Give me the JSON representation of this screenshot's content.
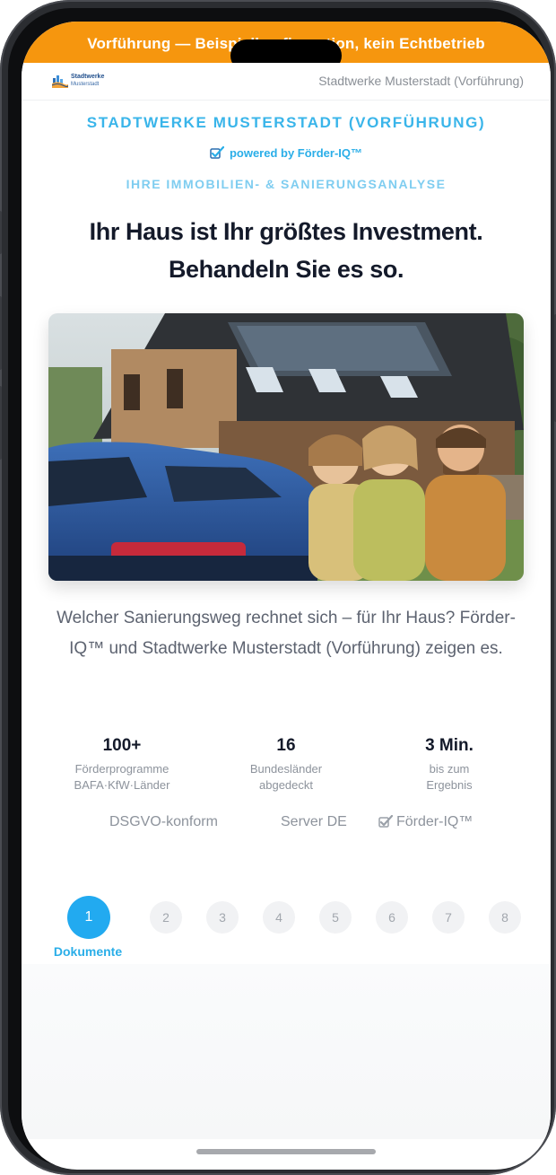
{
  "demo_banner": "Vorführung — Beispielkonfiguration, kein Echtbetrieb",
  "topbar": {
    "logo_line1": "Stadtwerke",
    "logo_line2": "Musterstadt",
    "partner_name": "Stadtwerke Musterstadt (Vorführung)"
  },
  "brand": {
    "title": "STADTWERKE MUSTERSTADT (VORFÜHRUNG)",
    "powered_by": "powered by Förder-IQ™",
    "eyebrow": "IHRE IMMOBILIEN- & SANIERUNGSANALYSE"
  },
  "headline": {
    "line1": "Ihr Haus ist Ihr größtes Investment.",
    "line2": "Behandeln Sie es so."
  },
  "hero_image": {
    "icon": "house-family-photo"
  },
  "intro_text": "Welcher Sanierungsweg rechnet sich – für Ihr Haus? Förder-IQ™ und Stadtwerke Musterstadt (Vorführung) zeigen es.",
  "stats": [
    {
      "value": "100+",
      "label_line1": "Förderprogramme",
      "label_line2": "BAFA·KfW·Länder"
    },
    {
      "value": "16",
      "label_line1": "Bundesländer",
      "label_line2": "abgedeckt"
    },
    {
      "value": "3 Min.",
      "label_line1": "bis zum",
      "label_line2": "Ergebnis"
    }
  ],
  "trust": {
    "item1": "DSGVO-konform",
    "item2": "Server DE",
    "item3": "Förder-IQ™"
  },
  "steps": {
    "items": [
      "1",
      "2",
      "3",
      "4",
      "5",
      "6",
      "7",
      "8"
    ],
    "active_index": 0,
    "active_label": "Dokumente"
  },
  "colors": {
    "banner": "#f6960e",
    "accent": "#22aaf0",
    "headline": "#141a2a"
  }
}
